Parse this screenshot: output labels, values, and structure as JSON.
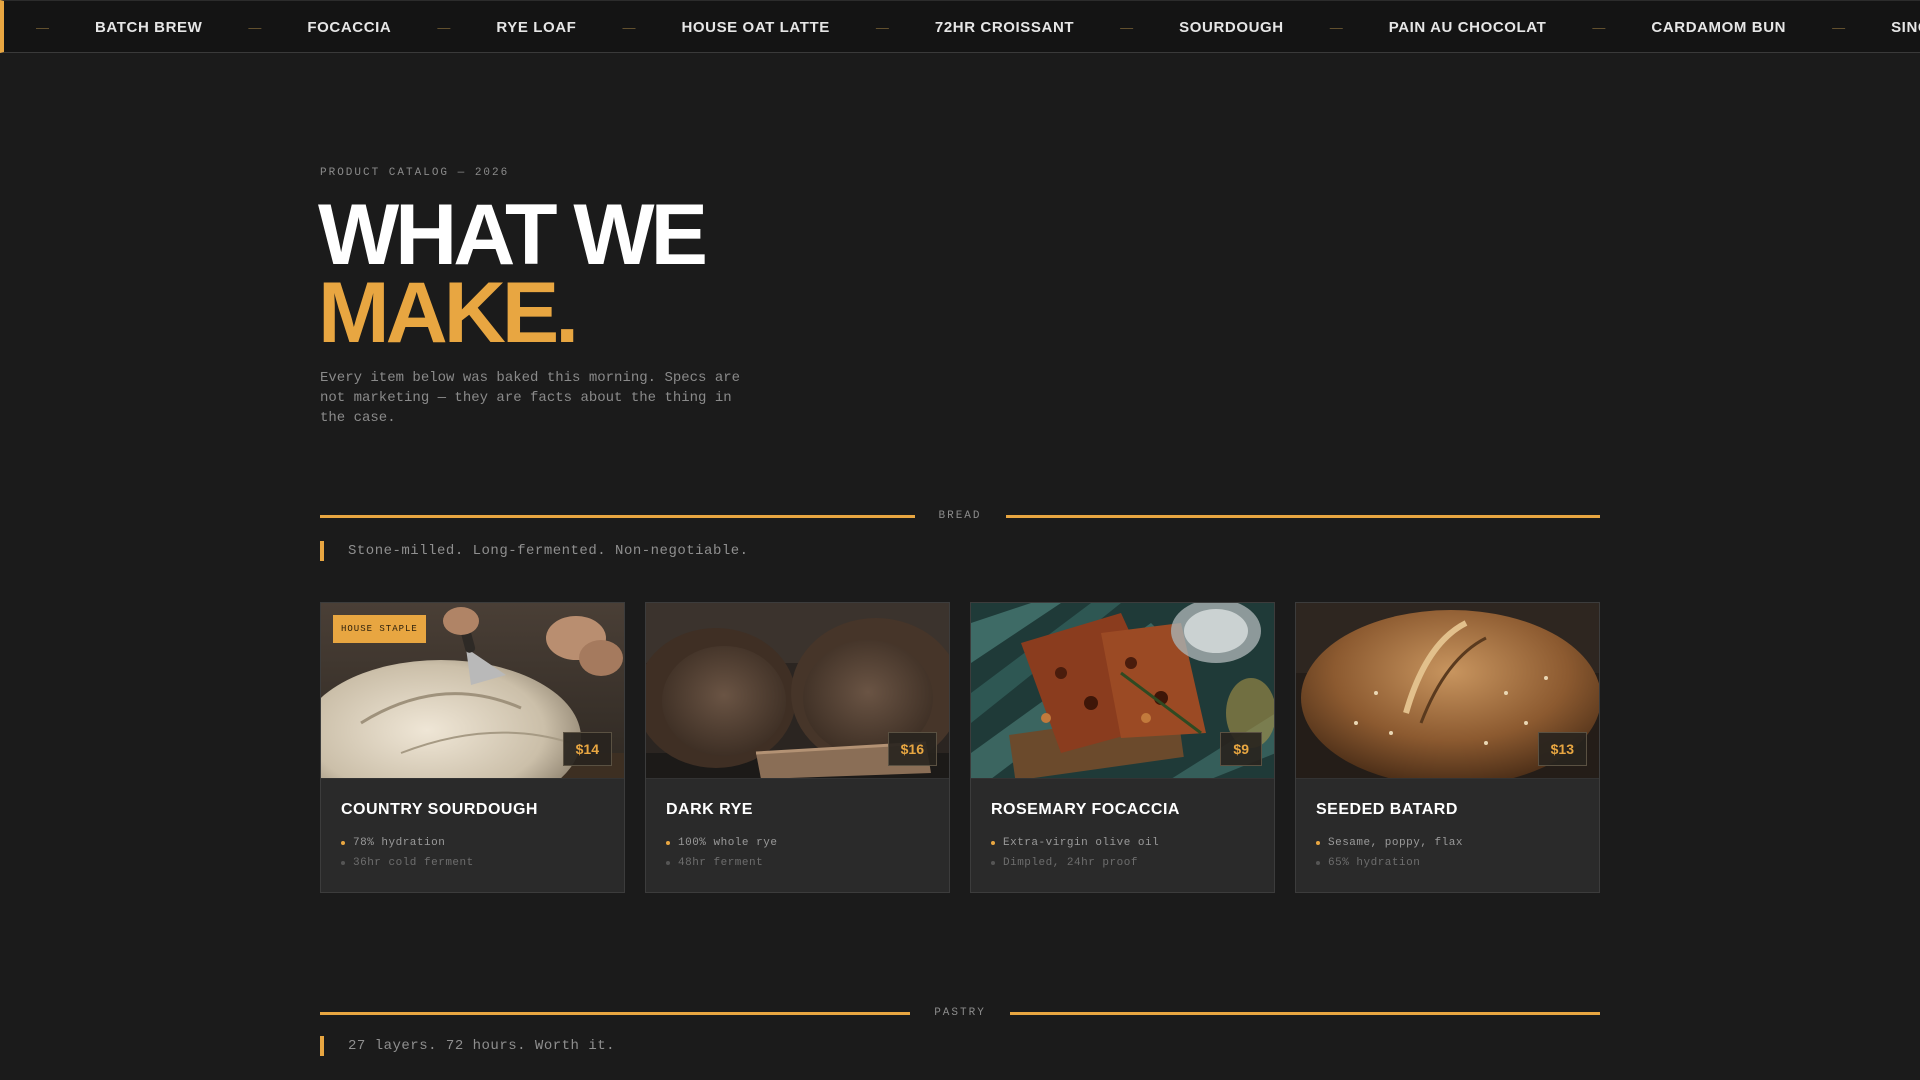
{
  "marquee": {
    "items": [
      "BATCH BREW",
      "FOCACCIA",
      "RYE LOAF",
      "HOUSE OAT LATTE",
      "72HR CROISSANT",
      "SOURDOUGH",
      "PAIN AU CHOCOLAT",
      "CARDAMOM BUN",
      "SINGLE-OI"
    ],
    "separator": "—"
  },
  "hero": {
    "eyebrow": "PRODUCT CATALOG — 2026",
    "title_line1": "WHAT WE",
    "title_line2": "MAKE.",
    "description": "Every item below was baked this morning. Specs are not marketing — they are facts about the thing in the case."
  },
  "sections": [
    {
      "label": "BREAD",
      "tagline": "Stone-milled. Long-fermented. Non-negotiable.",
      "products": [
        {
          "name": "COUNTRY SOURDOUGH",
          "price": "$14",
          "badge": "HOUSE STAPLE",
          "specs": [
            "78% hydration",
            "36hr cold ferment"
          ],
          "image": "scored-sourdough-photo"
        },
        {
          "name": "DARK RYE",
          "price": "$16",
          "badge": "",
          "specs": [
            "100% whole rye",
            "48hr ferment"
          ],
          "image": "sliced-rye-photo"
        },
        {
          "name": "ROSEMARY FOCACCIA",
          "price": "$9",
          "badge": "",
          "specs": [
            "Extra-virgin olive oil",
            "Dimpled, 24hr proof"
          ],
          "image": "focaccia-photo"
        },
        {
          "name": "SEEDED BATARD",
          "price": "$13",
          "badge": "",
          "specs": [
            "Sesame, poppy, flax",
            "65% hydration"
          ],
          "image": "seeded-batard-photo"
        }
      ]
    },
    {
      "label": "PASTRY",
      "tagline": "27 layers. 72 hours. Worth it."
    }
  ],
  "colors": {
    "background": "#1b1b1b",
    "accent": "#e8a641",
    "card": "#2a2a2a",
    "text": "#ffffff",
    "muted": "#8a8a8a"
  }
}
